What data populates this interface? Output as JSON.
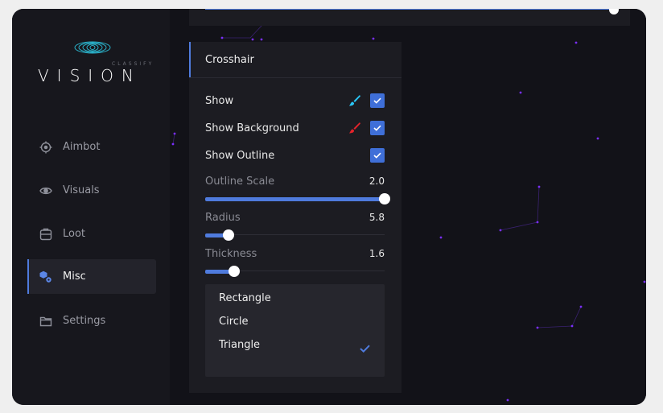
{
  "brand": {
    "small": "CLASSIFY",
    "big": "VISION"
  },
  "sidebar": {
    "items": [
      {
        "label": "Aimbot",
        "icon": "crosshair-icon"
      },
      {
        "label": "Visuals",
        "icon": "eye-icon"
      },
      {
        "label": "Loot",
        "icon": "backpack-icon"
      },
      {
        "label": "Misc",
        "icon": "cubes-gear-icon",
        "active": true
      },
      {
        "label": "Settings",
        "icon": "folder-icon"
      }
    ]
  },
  "crosshair": {
    "title": "Crosshair",
    "show_label": "Show",
    "show_checked": true,
    "show_color": "#29c5f6",
    "show_background_label": "Show Background",
    "show_background_checked": true,
    "show_background_color": "#e3232b",
    "show_outline_label": "Show Outline",
    "show_outline_checked": true,
    "outline_scale": {
      "label": "Outline Scale",
      "value": "2.0",
      "fraction": 1.0
    },
    "radius": {
      "label": "Radius",
      "value": "5.8",
      "fraction": 0.13
    },
    "thickness": {
      "label": "Thickness",
      "value": "1.6",
      "fraction": 0.16
    },
    "shape_options": [
      "Rectangle",
      "Circle",
      "Triangle"
    ],
    "shape_selected": "Triangle"
  },
  "colors": {
    "accent": "#4f7bdd",
    "particles": "#7b2fff"
  }
}
